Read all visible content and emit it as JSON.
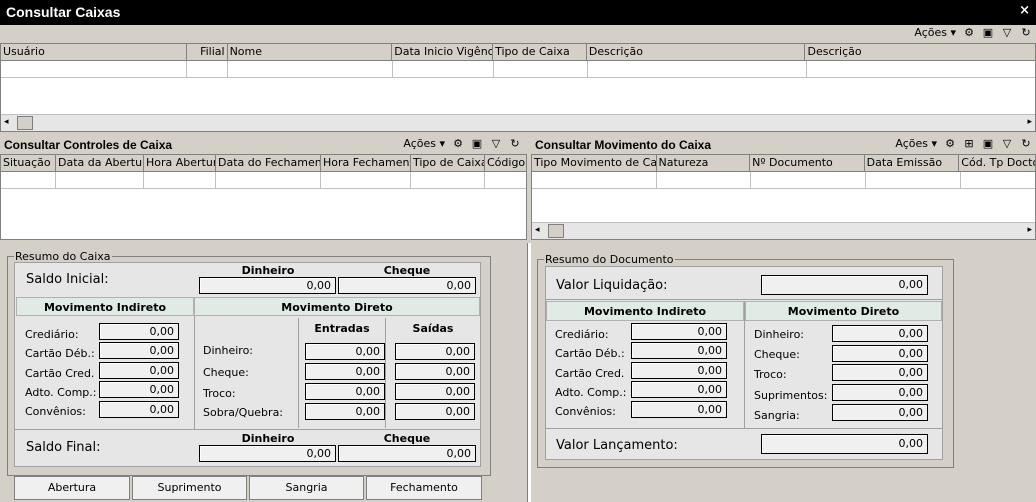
{
  "window": {
    "title": "Consultar Caixas",
    "close": "×"
  },
  "acoes": "Ações",
  "icons": {
    "config": "⚙",
    "drop": "▾",
    "restore": "▣",
    "filter": "▽",
    "refresh": "↻",
    "addrow": "⊞"
  },
  "caixas": {
    "columns": [
      "Usuário",
      "Filial",
      "Nome",
      "Data Inicio Vigência",
      "Tipo de Caixa",
      "Descrição",
      "Descrição"
    ]
  },
  "controles": {
    "title": "Consultar Controles de Caixa",
    "columns": [
      "Situação",
      "Data da Abertura",
      "Hora Abertura",
      "Data do Fechamento",
      "Hora Fechamento",
      "Tipo de Caixa",
      "Código"
    ]
  },
  "movimento": {
    "title": "Consultar Movimento do Caixa",
    "columns": [
      "Tipo Movimento de Caixa",
      "Natureza",
      "Nº Documento",
      "Data Emissão",
      "Cód. Tp Docto"
    ]
  },
  "resumo_caixa": {
    "legend": "Resumo do Caixa",
    "saldo_inicial": "Saldo Inicial:",
    "dinheiro": "Dinheiro",
    "cheque": "Cheque",
    "si_dinheiro": "0,00",
    "si_cheque": "0,00",
    "mov_indireto": "Movimento Indireto",
    "mov_direto": "Movimento Direto",
    "entradas": "Entradas",
    "saidas": "Saídas",
    "ind_labels": [
      "Crediário:",
      "Cartão Déb.:",
      "Cartão Cred.",
      "Adto. Comp.:",
      "Convênios:"
    ],
    "ind_values": [
      "0,00",
      "0,00",
      "0,00",
      "0,00",
      "0,00"
    ],
    "dir_labels": [
      "Dinheiro:",
      "Cheque:",
      "Troco:",
      "Sobra/Quebra:"
    ],
    "ent_values": [
      "0,00",
      "0,00",
      "0,00",
      "0,00"
    ],
    "sai_values": [
      "0,00",
      "0,00",
      "0,00",
      "0,00"
    ],
    "saldo_final": "Saldo Final:",
    "sf_dinheiro": "0,00",
    "sf_cheque": "0,00"
  },
  "buttons": [
    "Abertura",
    "Suprimento",
    "Sangria",
    "Fechamento"
  ],
  "resumo_doc": {
    "legend": "Resumo do Documento",
    "valor_liq": "Valor Liquidação:",
    "valor_liq_val": "0,00",
    "mov_indireto": "Movimento Indireto",
    "mov_direto": "Movimento Direto",
    "ind_labels": [
      "Crediário:",
      "Cartão Déb.:",
      "Cartão Cred.",
      "Adto. Comp.:",
      "Convênios:"
    ],
    "ind_values": [
      "0,00",
      "0,00",
      "0,00",
      "0,00",
      "0,00"
    ],
    "dir_labels": [
      "Dinheiro:",
      "Cheque:",
      "Troco:",
      "Suprimentos:",
      "Sangria:"
    ],
    "dir_values": [
      "0,00",
      "0,00",
      "0,00",
      "0,00",
      "0,00"
    ],
    "valor_lanc": "Valor Lançamento:",
    "valor_lanc_val": "0,00"
  }
}
